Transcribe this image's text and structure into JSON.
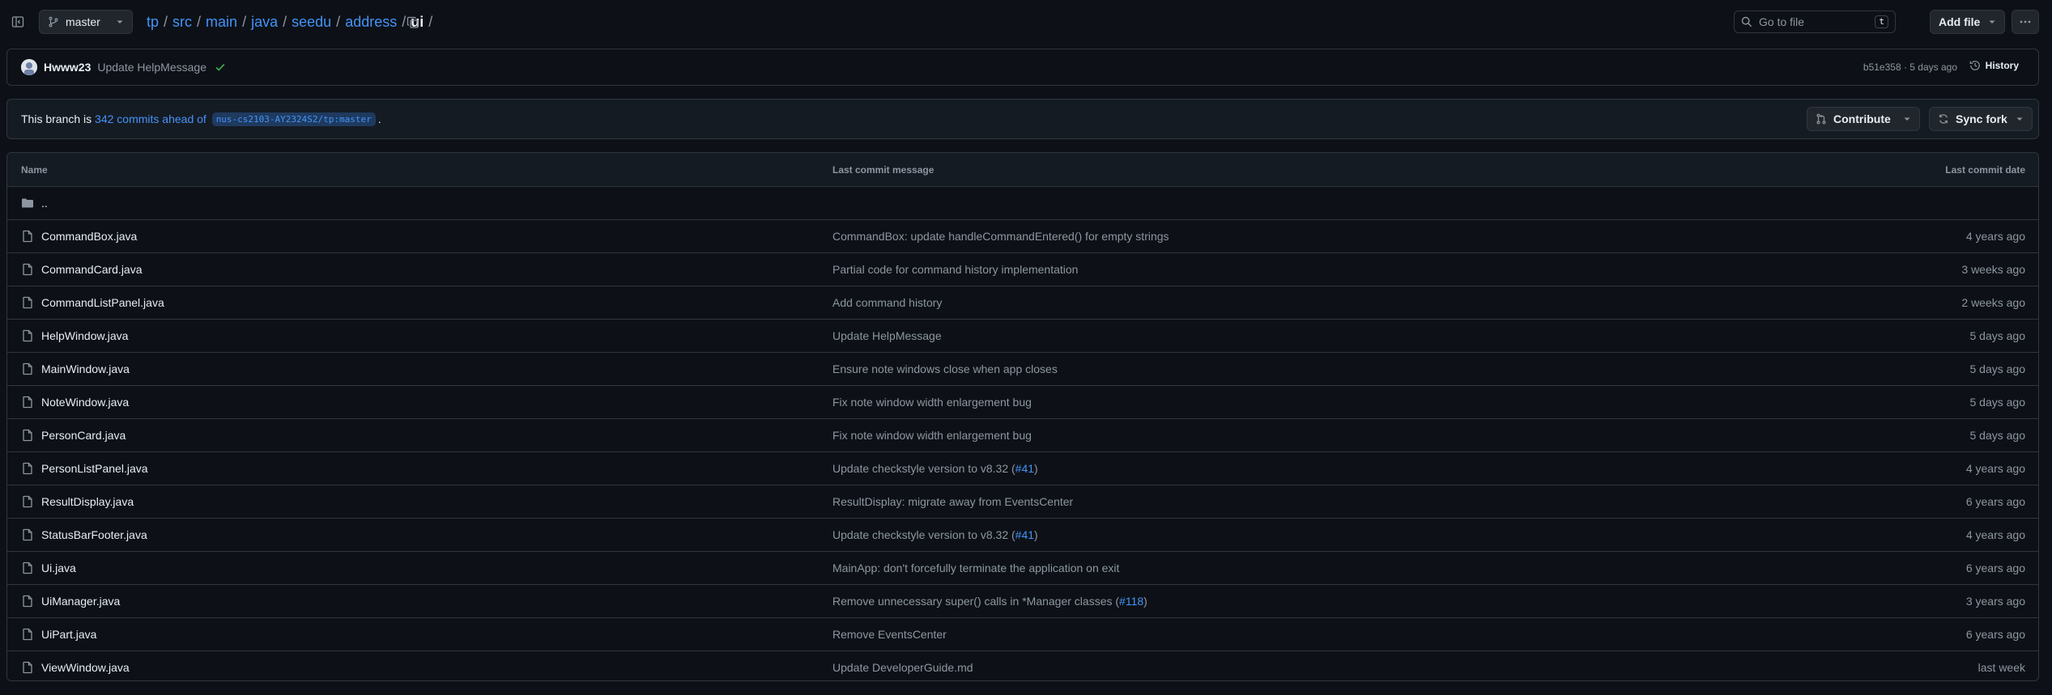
{
  "branch": "master",
  "breadcrumb": [
    {
      "label": "tp",
      "link": true
    },
    {
      "label": "src",
      "link": true
    },
    {
      "label": "main",
      "link": true
    },
    {
      "label": "java",
      "link": true
    },
    {
      "label": "seedu",
      "link": true
    },
    {
      "label": "address",
      "link": true
    },
    {
      "label": "ui",
      "link": false
    }
  ],
  "breadcrumb_sep": "/",
  "search": {
    "placeholder": "Go to file",
    "shortcut": "t"
  },
  "add_file_label": "Add file",
  "latest_commit": {
    "author": "Hwww23",
    "message": "Update HelpMessage",
    "sha_date": "b51e358 · 5 days ago",
    "history_label": "History"
  },
  "ahead": {
    "prefix": "This branch is",
    "link": "342 commits ahead of",
    "ref": "nus-cs2103-AY2324S2/tp:master",
    "suffix": ".",
    "contribute_label": "Contribute",
    "sync_label": "Sync fork"
  },
  "table": {
    "headers": {
      "name": "Name",
      "message": "Last commit message",
      "date": "Last commit date"
    },
    "parent": "..",
    "rows": [
      {
        "name": "CommandBox.java",
        "msg": "CommandBox: update handleCommandEntered() for empty strings",
        "date": "4 years ago"
      },
      {
        "name": "CommandCard.java",
        "msg": "Partial code for command history implementation",
        "date": "3 weeks ago"
      },
      {
        "name": "CommandListPanel.java",
        "msg": "Add command history",
        "date": "2 weeks ago"
      },
      {
        "name": "HelpWindow.java",
        "msg": "Update HelpMessage",
        "date": "5 days ago"
      },
      {
        "name": "MainWindow.java",
        "msg": "Ensure note windows close when app closes",
        "date": "5 days ago"
      },
      {
        "name": "NoteWindow.java",
        "msg": "Fix note window width enlargement bug",
        "date": "5 days ago"
      },
      {
        "name": "PersonCard.java",
        "msg": "Fix note window width enlargement bug",
        "date": "5 days ago"
      },
      {
        "name": "PersonListPanel.java",
        "msg": "Update checkstyle version to v8.32 (",
        "msg_link": "#41",
        "msg_end": ")",
        "date": "4 years ago"
      },
      {
        "name": "ResultDisplay.java",
        "msg": "ResultDisplay: migrate away from EventsCenter",
        "date": "6 years ago"
      },
      {
        "name": "StatusBarFooter.java",
        "msg": "Update checkstyle version to v8.32 (",
        "msg_link": "#41",
        "msg_end": ")",
        "date": "4 years ago"
      },
      {
        "name": "Ui.java",
        "msg": "MainApp: don't forcefully terminate the application on exit",
        "date": "6 years ago"
      },
      {
        "name": "UiManager.java",
        "msg": "Remove unnecessary super() calls in *Manager classes (",
        "msg_link": "#118",
        "msg_end": ")",
        "date": "3 years ago"
      },
      {
        "name": "UiPart.java",
        "msg": "Remove EventsCenter",
        "date": "6 years ago"
      },
      {
        "name": "ViewWindow.java",
        "msg": "Update DeveloperGuide.md",
        "date": "last week"
      }
    ]
  },
  "icons": {
    "sidebar": "sidebar-toggle-icon",
    "branch": "git-branch-icon",
    "copy": "copy-icon",
    "search": "search-icon",
    "more": "kebab-icon",
    "folder": "folder-icon",
    "file": "file-icon",
    "check": "check-icon",
    "history": "clock-history-icon",
    "pr": "git-pull-request-icon",
    "sync": "sync-icon"
  },
  "colors": {
    "accent": "#4493f8",
    "success": "#3fb950",
    "bg": "#0d1117"
  }
}
